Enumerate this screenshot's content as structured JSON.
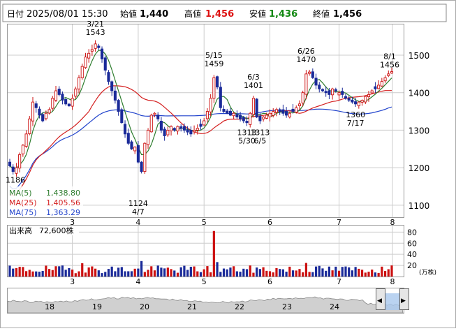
{
  "header": {
    "date_label": "日付",
    "datetime": "2025/08/01 15:30",
    "open_label": "始値",
    "open_value": "1,440",
    "high_label": "高値",
    "high_value": "1,456",
    "low_label": "安値",
    "low_value": "1,436",
    "close_label": "終値",
    "close_value": "1,456"
  },
  "legend": [
    {
      "label": "MA(5)",
      "value": "1,438.80",
      "color": "#2e7d2e"
    },
    {
      "label": "MA(25)",
      "value": "1,405.56",
      "color": "#d42020"
    },
    {
      "label": "MA(75)",
      "value": "1,363.29",
      "color": "#2244cc"
    }
  ],
  "volume_panel": {
    "label": "出来高",
    "value": "72,600株",
    "unit": "(万株)"
  },
  "colors": {
    "up": "#cc1111",
    "down": "#1a2a99",
    "grid": "#cccccc",
    "frame": "#999999",
    "high_text": "#dd1111",
    "low_text": "#118811",
    "scroll_fill": "#d0d0d0"
  },
  "chart_data": {
    "type": "candlestick",
    "y_range": [
      1070,
      1580
    ],
    "y_ticks": [
      "1100",
      "1200",
      "1300",
      "1400",
      "1500"
    ],
    "month_ticks": [
      "3",
      "4",
      "5",
      "6",
      "7",
      "8"
    ],
    "volume_range": [
      0,
      88
    ],
    "volume_ticks": [
      "20",
      "40",
      "60",
      "80"
    ],
    "annotations": [
      {
        "text": "1186",
        "date_index": 0,
        "value": 1186,
        "kind": "low"
      },
      {
        "text": "3/21",
        "date_index": 26,
        "value": 1543,
        "kind": "high"
      },
      {
        "text": "1543",
        "date_index": 26,
        "value": 1543,
        "kind": "high"
      },
      {
        "text": "1124",
        "date_index": 39,
        "value": 1124,
        "kind": "low"
      },
      {
        "text": "4/7",
        "date_index": 39,
        "value": 1124,
        "kind": "low"
      },
      {
        "text": "5/15",
        "date_index": 62,
        "value": 1459,
        "kind": "high"
      },
      {
        "text": "1459",
        "date_index": 62,
        "value": 1459,
        "kind": "high"
      },
      {
        "text": "6/3",
        "date_index": 74,
        "value": 1401,
        "kind": "high"
      },
      {
        "text": "1401",
        "date_index": 74,
        "value": 1401,
        "kind": "high"
      },
      {
        "text": "1313",
        "date_index": 72,
        "value": 1313,
        "kind": "low"
      },
      {
        "text": "5/30",
        "date_index": 72,
        "value": 1313,
        "kind": "low"
      },
      {
        "text": "1313",
        "date_index": 76,
        "value": 1313,
        "kind": "low"
      },
      {
        "text": "6/5",
        "date_index": 76,
        "value": 1313,
        "kind": "low"
      },
      {
        "text": "6/26",
        "date_index": 90,
        "value": 1470,
        "kind": "high"
      },
      {
        "text": "1470",
        "date_index": 90,
        "value": 1470,
        "kind": "high"
      },
      {
        "text": "1360",
        "date_index": 105,
        "value": 1360,
        "kind": "low"
      },
      {
        "text": "7/17",
        "date_index": 105,
        "value": 1360,
        "kind": "low"
      },
      {
        "text": "8/1",
        "date_index": 116,
        "value": 1456,
        "kind": "high"
      },
      {
        "text": "1456",
        "date_index": 116,
        "value": 1456,
        "kind": "high"
      }
    ],
    "closes": [
      1205,
      1190,
      1200,
      1235,
      1260,
      1290,
      1330,
      1375,
      1360,
      1340,
      1325,
      1345,
      1355,
      1385,
      1405,
      1395,
      1380,
      1370,
      1365,
      1385,
      1410,
      1440,
      1470,
      1495,
      1505,
      1515,
      1530,
      1520,
      1490,
      1460,
      1430,
      1405,
      1380,
      1350,
      1320,
      1290,
      1265,
      1250,
      1255,
      1215,
      1190,
      1265,
      1300,
      1340,
      1345,
      1330,
      1300,
      1285,
      1300,
      1310,
      1300,
      1310,
      1305,
      1300,
      1295,
      1290,
      1300,
      1305,
      1310,
      1325,
      1350,
      1385,
      1440,
      1415,
      1360,
      1350,
      1345,
      1340,
      1345,
      1335,
      1330,
      1325,
      1320,
      1345,
      1385,
      1335,
      1325,
      1335,
      1340,
      1345,
      1350,
      1355,
      1350,
      1345,
      1340,
      1345,
      1350,
      1360,
      1370,
      1400,
      1450,
      1455,
      1440,
      1420,
      1410,
      1405,
      1400,
      1395,
      1410,
      1405,
      1400,
      1395,
      1385,
      1380,
      1375,
      1370,
      1375,
      1380,
      1390,
      1395,
      1405,
      1410,
      1420,
      1430,
      1440,
      1450,
      1456
    ]
  },
  "scrollbar": {
    "labels": [
      "18",
      "19",
      "20",
      "21",
      "22",
      "23",
      "24"
    ],
    "left_arrow": "◀",
    "right_arrow": "▶"
  }
}
